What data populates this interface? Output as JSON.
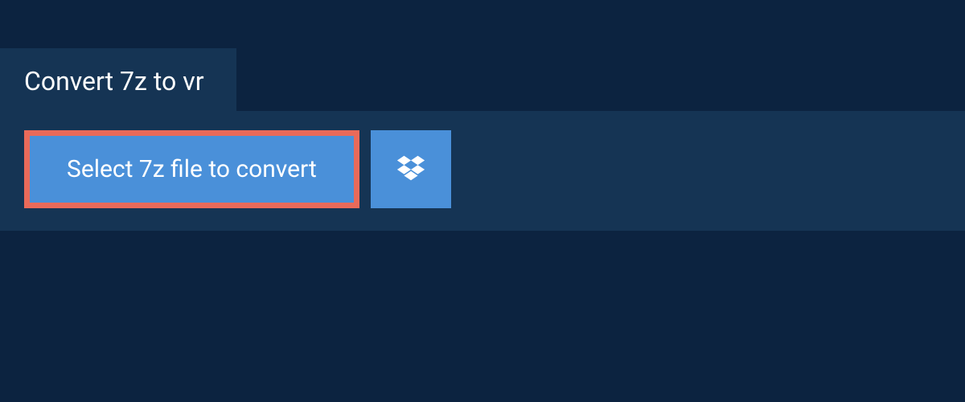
{
  "tab": {
    "label": "Convert 7z to vr"
  },
  "actions": {
    "select_file_label": "Select 7z file to convert"
  }
}
